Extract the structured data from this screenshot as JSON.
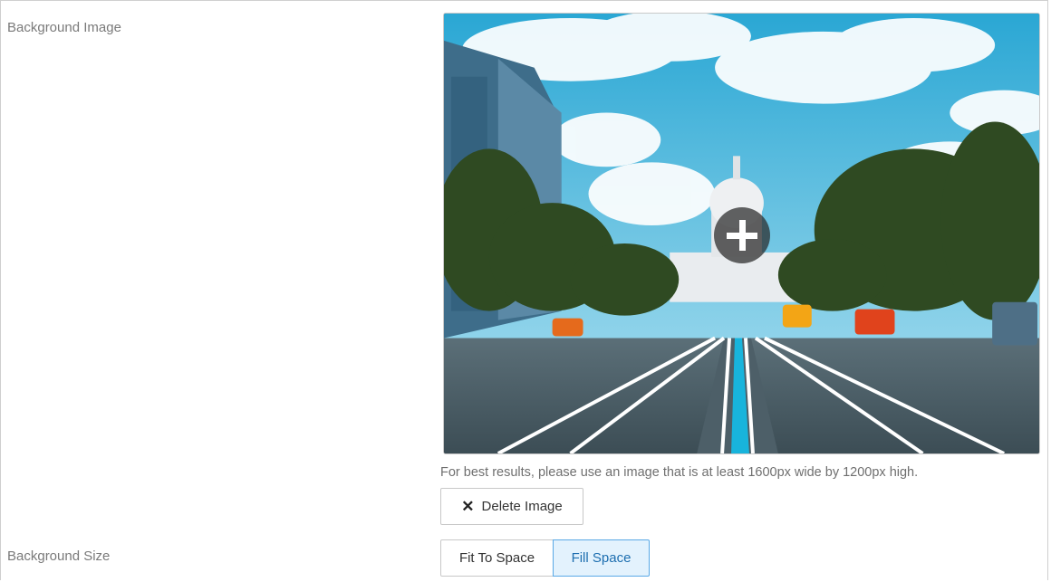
{
  "background_image": {
    "label": "Background Image",
    "add_icon": "plus-icon",
    "hint": "For best results, please use an image that is at least 1600px wide by 1200px high.",
    "delete_label": "Delete Image",
    "delete_icon": "close-icon"
  },
  "background_size": {
    "label": "Background Size",
    "options": [
      "Fit To Space",
      "Fill Space"
    ],
    "selected": "Fill Space"
  },
  "colors": {
    "accent": "#5aa9e6",
    "selected_bg": "#e3f2fd"
  }
}
